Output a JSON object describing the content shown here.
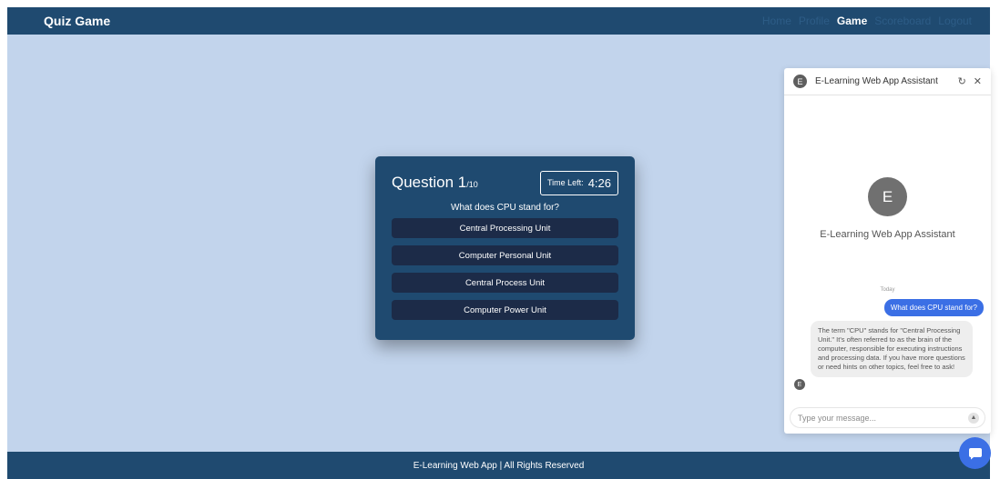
{
  "navbar": {
    "brand": "Quiz Game",
    "links": [
      {
        "label": "Home"
      },
      {
        "label": "Profile"
      },
      {
        "label": "Game"
      },
      {
        "label": "Scoreboard"
      },
      {
        "label": "Logout"
      }
    ],
    "active": "Game"
  },
  "quiz": {
    "title": "Question 1",
    "count": "/10",
    "timer_label": "Time Left:",
    "timer_value": "4:26",
    "question": "What does CPU stand for?",
    "answers": [
      "Central Processing Unit",
      "Computer Personal Unit",
      "Central Process Unit",
      "Computer Power Unit"
    ]
  },
  "chat": {
    "header_title": "E-Learning Web App Assistant",
    "avatar_letter": "E",
    "bot_name": "E-Learning Web App Assistant",
    "day_label": "Today",
    "user_message": "What does CPU stand for?",
    "bot_message": "The term \"CPU\" stands for \"Central Processing Unit.\" It's often referred to as the brain of the computer, responsible for executing instructions and processing data. If you have more questions or need hints on other topics, feel free to ask!",
    "input_placeholder": "Type your message...",
    "icons": {
      "refresh": "refresh-icon",
      "close": "close-icon",
      "send": "send-icon",
      "fab": "chat-bubble-icon"
    }
  },
  "footer": {
    "text": "E-Learning Web App | All Rights Reserved"
  },
  "colors": {
    "navbar": "#1f4a70",
    "page_background": "#c2d4ec",
    "answer_button": "#1c2b48",
    "chat_accent": "#3b6fe5"
  }
}
